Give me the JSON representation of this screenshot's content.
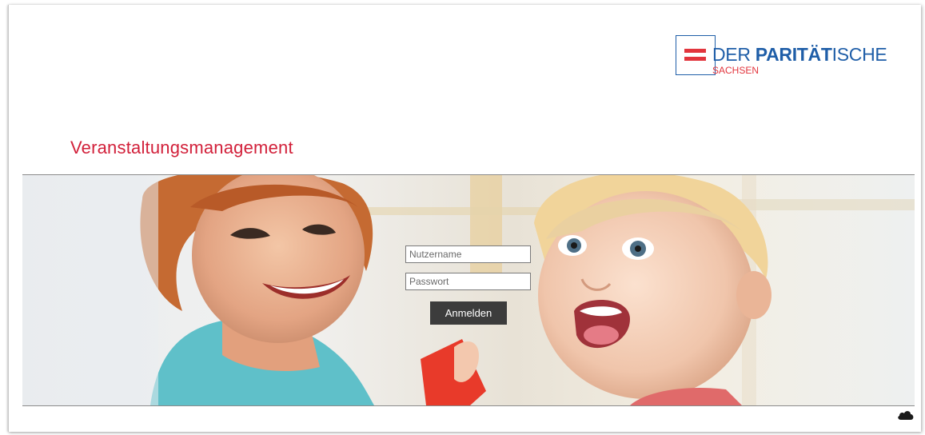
{
  "brand": {
    "name_regular_1": "DER ",
    "name_bold": "PARITÄT",
    "name_regular_2": "ISCHE",
    "region": "SACHSEN",
    "color_blue": "#1f5ea8",
    "color_red": "#e2353d"
  },
  "page": {
    "title": "Veranstaltungsmanagement",
    "title_color": "#d2203a"
  },
  "login": {
    "username_placeholder": "Nutzername",
    "password_placeholder": "Passwort",
    "submit_label": "Anmelden"
  },
  "icons": {
    "footer": "cloud-icon"
  }
}
